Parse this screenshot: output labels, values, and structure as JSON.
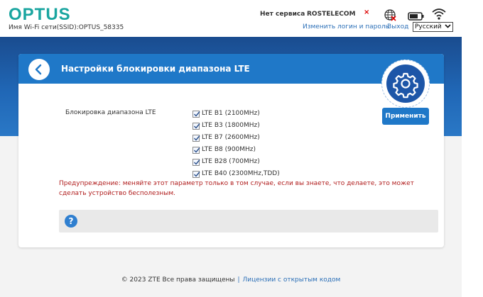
{
  "header": {
    "logo": "OPTUS",
    "ssid_text": "Имя Wi-Fi сети(SSID):OPTUS_58335",
    "network_status": "Нет сервиса",
    "operator": "ROSTELECOM",
    "status_x": "×",
    "change_login_link": "Изменить логин и пароль",
    "logout_link": "Выход",
    "language": "Русский"
  },
  "page": {
    "title": "Настройки блокировки диапазона LTE",
    "field_label": "Блокировка диапазона LTE",
    "bands": [
      {
        "label": "LTE B1 (2100MHz)",
        "checked": true
      },
      {
        "label": "LTE B3 (1800MHz)",
        "checked": true
      },
      {
        "label": "LTE B7 (2600MHz)",
        "checked": true
      },
      {
        "label": "LTE B8 (900MHz)",
        "checked": true
      },
      {
        "label": "LTE B28 (700MHz)",
        "checked": true
      },
      {
        "label": "LTE B40 (2300MHz,TDD)",
        "checked": true
      }
    ],
    "apply_button": "Применить",
    "warning": "Предупреждение: меняйте этот параметр только в том случае, если вы знаете, что делаете, это может сделать устройство бесполезным.",
    "help_icon": "?"
  },
  "footer": {
    "copyright": "© 2023 ZTE Все права защищены",
    "separator": "|",
    "licenses_link": "Лицензии с открытым кодом"
  },
  "icons": {
    "back": "chevron-left-icon",
    "settings": "gear-icon",
    "globe": "globe-blocked-icon",
    "battery": "battery-icon",
    "wifi": "wifi-icon",
    "help": "question-icon"
  },
  "colors": {
    "brand": "#1aa5a0",
    "accent": "#1f78c8",
    "warning": "#b01c1c",
    "link": "#2b6fb7"
  }
}
